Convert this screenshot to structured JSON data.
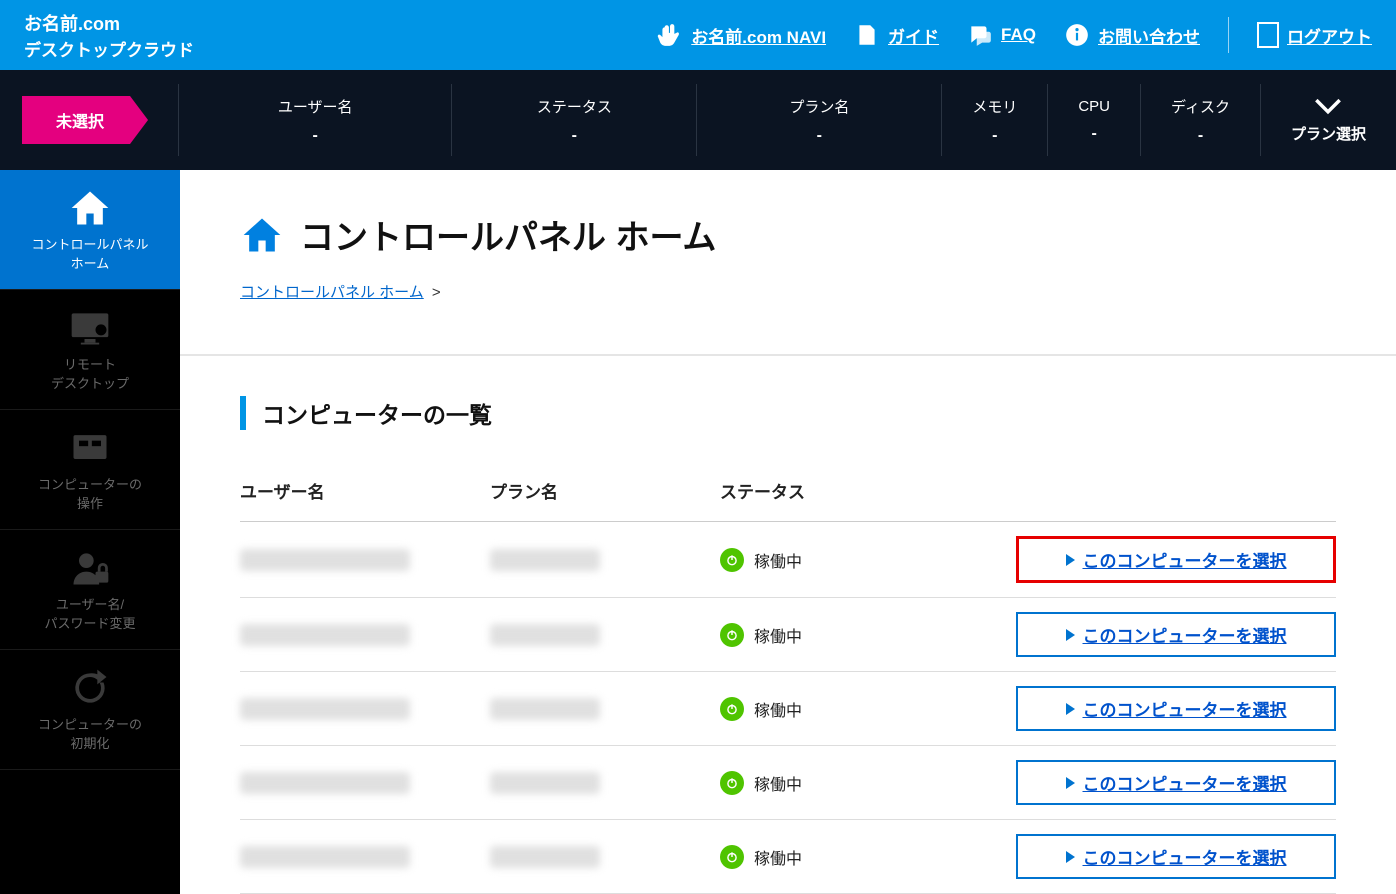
{
  "header": {
    "logo_line1": "お名前.com",
    "logo_line2": "デスクトップクラウド",
    "nav": [
      {
        "label": "お名前.com NAVI"
      },
      {
        "label": "ガイド"
      },
      {
        "label": "FAQ"
      },
      {
        "label": "お問い合わせ"
      }
    ],
    "logout": "ログアウト"
  },
  "status_bar": {
    "badge": "未選択",
    "cells": [
      {
        "label": "ユーザー名",
        "value": "-"
      },
      {
        "label": "ステータス",
        "value": "-"
      },
      {
        "label": "プラン名",
        "value": "-"
      },
      {
        "label": "メモリ",
        "value": "-"
      },
      {
        "label": "CPU",
        "value": "-"
      },
      {
        "label": "ディスク",
        "value": "-"
      }
    ],
    "plan_select": "プラン選択"
  },
  "sidebar": {
    "items": [
      {
        "label": "コントロールパネル\nホーム"
      },
      {
        "label": "リモート\nデスクトップ"
      },
      {
        "label": "コンピューターの\n操作"
      },
      {
        "label": "ユーザー名/\nパスワード変更"
      },
      {
        "label": "コンピューターの\n初期化"
      }
    ]
  },
  "page": {
    "title": "コントロールパネル ホーム",
    "breadcrumb": "コントロールパネル ホーム",
    "section_title": "コンピューターの一覧",
    "columns": {
      "user": "ユーザー名",
      "plan": "プラン名",
      "status": "ステータス"
    },
    "rows": [
      {
        "status": "稼働中",
        "action": "このコンピューターを選択",
        "highlight": true
      },
      {
        "status": "稼働中",
        "action": "このコンピューターを選択",
        "highlight": false
      },
      {
        "status": "稼働中",
        "action": "このコンピューターを選択",
        "highlight": false
      },
      {
        "status": "稼働中",
        "action": "このコンピューターを選択",
        "highlight": false
      },
      {
        "status": "稼働中",
        "action": "このコンピューターを選択",
        "highlight": false
      }
    ]
  }
}
